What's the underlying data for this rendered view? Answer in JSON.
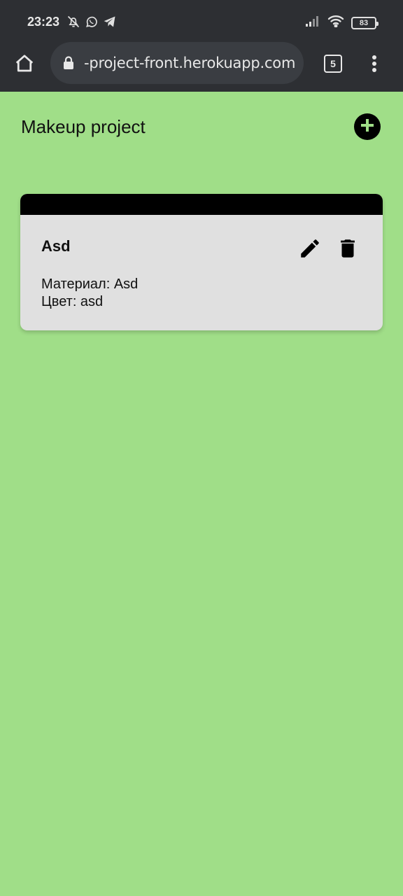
{
  "status_bar": {
    "time": "23:23",
    "left_icons": [
      "bell-off-icon",
      "whatsapp-icon",
      "telegram-icon"
    ],
    "right_icons": [
      "signal-icon",
      "wifi-icon"
    ],
    "battery": "83"
  },
  "browser": {
    "url": "-project-front.herokuapp.com",
    "tab_count": "5",
    "chrome_color": "#2d2f33"
  },
  "page": {
    "title": "Makeup project",
    "background_color": "#a0de88"
  },
  "cards": [
    {
      "title": "Asd",
      "material_line": "Материал: Asd",
      "color_line": "Цвет: asd",
      "actions": [
        "edit-icon",
        "delete-icon"
      ]
    }
  ]
}
